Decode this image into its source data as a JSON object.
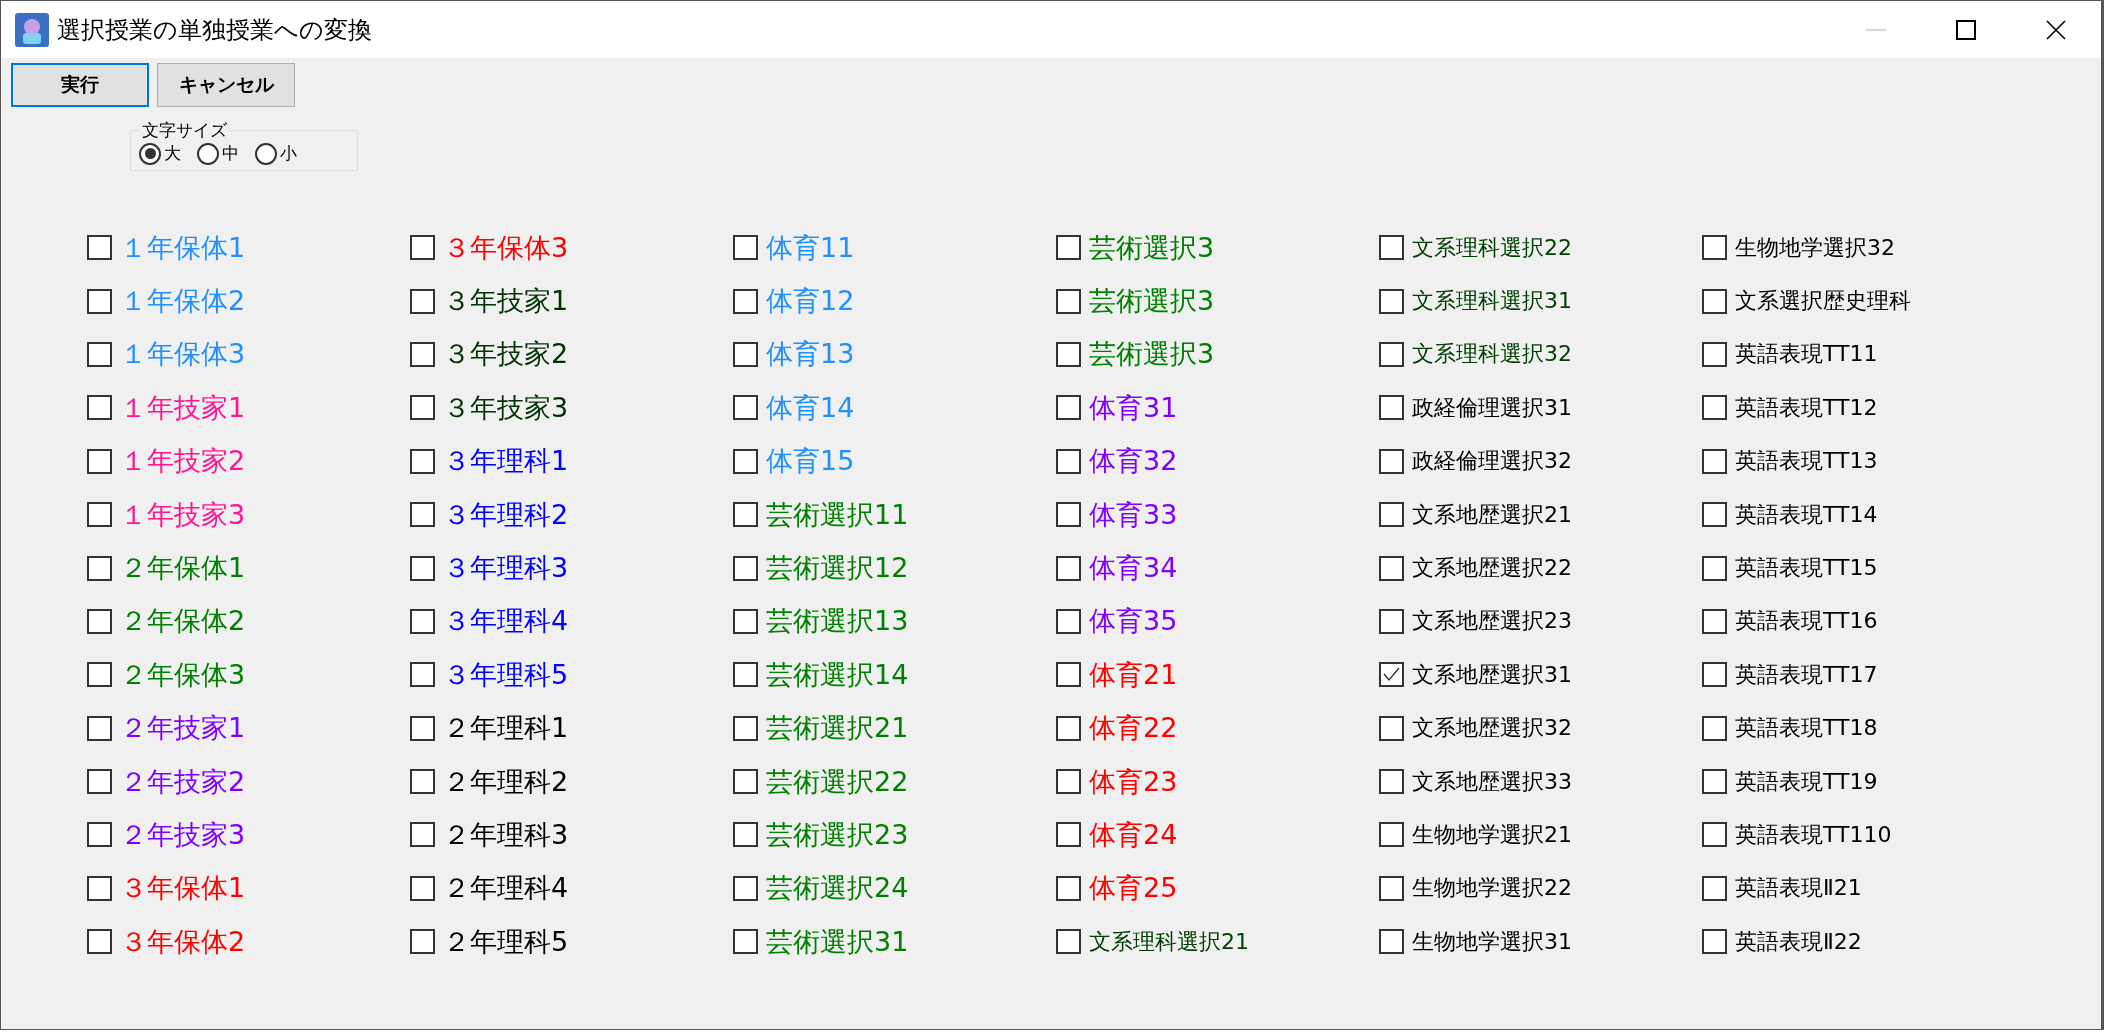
{
  "window": {
    "title": "選択授業の単独授業への変換"
  },
  "buttons": [
    {
      "label": "実行",
      "focused": true
    },
    {
      "label": "キャンセル",
      "focused": false
    }
  ],
  "font_size_group": {
    "title": "文字サイズ",
    "options": [
      {
        "label": "大",
        "selected": true
      },
      {
        "label": "中",
        "selected": false
      },
      {
        "label": "小",
        "selected": false
      }
    ]
  },
  "columns": [
    [
      {
        "label": "１年保体1",
        "color": "#1e90ff",
        "kind": "large",
        "checked": false
      },
      {
        "label": "１年保体2",
        "color": "#1e90ff",
        "kind": "large",
        "checked": false
      },
      {
        "label": "１年保体3",
        "color": "#1e90ff",
        "kind": "large",
        "checked": false
      },
      {
        "label": "１年技家1",
        "color": "#ff1493",
        "kind": "large",
        "checked": false
      },
      {
        "label": "１年技家2",
        "color": "#ff1493",
        "kind": "large",
        "checked": false
      },
      {
        "label": "１年技家3",
        "color": "#ff1493",
        "kind": "large",
        "checked": false
      },
      {
        "label": "２年保体1",
        "color": "#008000",
        "kind": "large",
        "checked": false
      },
      {
        "label": "２年保体2",
        "color": "#008000",
        "kind": "large",
        "checked": false
      },
      {
        "label": "２年保体3",
        "color": "#008000",
        "kind": "large",
        "checked": false
      },
      {
        "label": "２年技家1",
        "color": "#8000ff",
        "kind": "large",
        "checked": false
      },
      {
        "label": "２年技家2",
        "color": "#8000ff",
        "kind": "large",
        "checked": false
      },
      {
        "label": "２年技家3",
        "color": "#8000ff",
        "kind": "large",
        "checked": false
      },
      {
        "label": "３年保体1",
        "color": "#ff0000",
        "kind": "large",
        "checked": false
      },
      {
        "label": "３年保体2",
        "color": "#ff0000",
        "kind": "large",
        "checked": false
      }
    ],
    [
      {
        "label": "３年保体3",
        "color": "#ff0000",
        "kind": "large",
        "checked": false
      },
      {
        "label": "３年技家1",
        "color": "#003300",
        "kind": "large",
        "checked": false
      },
      {
        "label": "３年技家2",
        "color": "#003300",
        "kind": "large",
        "checked": false
      },
      {
        "label": "３年技家3",
        "color": "#003300",
        "kind": "large",
        "checked": false
      },
      {
        "label": "３年理科1",
        "color": "#0000ff",
        "kind": "large",
        "checked": false
      },
      {
        "label": "３年理科2",
        "color": "#0000ff",
        "kind": "large",
        "checked": false
      },
      {
        "label": "３年理科3",
        "color": "#0000ff",
        "kind": "large",
        "checked": false
      },
      {
        "label": "３年理科4",
        "color": "#0000ff",
        "kind": "large",
        "checked": false
      },
      {
        "label": "３年理科5",
        "color": "#0000ff",
        "kind": "large",
        "checked": false
      },
      {
        "label": "２年理科1",
        "color": "#000000",
        "kind": "large",
        "checked": false
      },
      {
        "label": "２年理科2",
        "color": "#000000",
        "kind": "large",
        "checked": false
      },
      {
        "label": "２年理科3",
        "color": "#000000",
        "kind": "large",
        "checked": false
      },
      {
        "label": "２年理科4",
        "color": "#000000",
        "kind": "large",
        "checked": false
      },
      {
        "label": "２年理科5",
        "color": "#000000",
        "kind": "large",
        "checked": false
      }
    ],
    [
      {
        "label": "体育11",
        "color": "#1e90ff",
        "kind": "large",
        "checked": false
      },
      {
        "label": "体育12",
        "color": "#1e90ff",
        "kind": "large",
        "checked": false
      },
      {
        "label": "体育13",
        "color": "#1e90ff",
        "kind": "large",
        "checked": false
      },
      {
        "label": "体育14",
        "color": "#1e90ff",
        "kind": "large",
        "checked": false
      },
      {
        "label": "体育15",
        "color": "#1e90ff",
        "kind": "large",
        "checked": false
      },
      {
        "label": "芸術選択11",
        "color": "#008000",
        "kind": "large",
        "checked": false
      },
      {
        "label": "芸術選択12",
        "color": "#008000",
        "kind": "large",
        "checked": false
      },
      {
        "label": "芸術選択13",
        "color": "#008000",
        "kind": "large",
        "checked": false
      },
      {
        "label": "芸術選択14",
        "color": "#008000",
        "kind": "large",
        "checked": false
      },
      {
        "label": "芸術選択21",
        "color": "#008000",
        "kind": "large",
        "checked": false
      },
      {
        "label": "芸術選択22",
        "color": "#008000",
        "kind": "large",
        "checked": false
      },
      {
        "label": "芸術選択23",
        "color": "#008000",
        "kind": "large",
        "checked": false
      },
      {
        "label": "芸術選択24",
        "color": "#008000",
        "kind": "large",
        "checked": false
      },
      {
        "label": "芸術選択31",
        "color": "#008000",
        "kind": "large",
        "checked": false
      }
    ],
    [
      {
        "label": "芸術選択3",
        "color": "#008000",
        "kind": "large",
        "checked": false
      },
      {
        "label": "芸術選択3",
        "color": "#008000",
        "kind": "large",
        "checked": false
      },
      {
        "label": "芸術選択3",
        "color": "#008000",
        "kind": "large",
        "checked": false
      },
      {
        "label": "体育31",
        "color": "#8000ff",
        "kind": "large",
        "checked": false
      },
      {
        "label": "体育32",
        "color": "#8000ff",
        "kind": "large",
        "checked": false
      },
      {
        "label": "体育33",
        "color": "#8000ff",
        "kind": "large",
        "checked": false
      },
      {
        "label": "体育34",
        "color": "#8000ff",
        "kind": "large",
        "checked": false
      },
      {
        "label": "体育35",
        "color": "#8000ff",
        "kind": "large",
        "checked": false
      },
      {
        "label": "体育21",
        "color": "#ff0000",
        "kind": "large",
        "checked": false
      },
      {
        "label": "体育22",
        "color": "#ff0000",
        "kind": "large",
        "checked": false
      },
      {
        "label": "体育23",
        "color": "#ff0000",
        "kind": "large",
        "checked": false
      },
      {
        "label": "体育24",
        "color": "#ff0000",
        "kind": "large",
        "checked": false
      },
      {
        "label": "体育25",
        "color": "#ff0000",
        "kind": "large",
        "checked": false
      },
      {
        "label": "文系理科選択21",
        "color": "#004000",
        "kind": "small",
        "checked": false
      }
    ],
    [
      {
        "label": "文系理科選択22",
        "color": "#004000",
        "kind": "small",
        "checked": false
      },
      {
        "label": "文系理科選択31",
        "color": "#004000",
        "kind": "small",
        "checked": false
      },
      {
        "label": "文系理科選択32",
        "color": "#004000",
        "kind": "small",
        "checked": false
      },
      {
        "label": "政経倫理選択31",
        "color": "#000000",
        "kind": "small",
        "checked": false
      },
      {
        "label": "政経倫理選択32",
        "color": "#000000",
        "kind": "small",
        "checked": false
      },
      {
        "label": "文系地歴選択21",
        "color": "#000000",
        "kind": "small",
        "checked": false
      },
      {
        "label": "文系地歴選択22",
        "color": "#000000",
        "kind": "small",
        "checked": false
      },
      {
        "label": "文系地歴選択23",
        "color": "#000000",
        "kind": "small",
        "checked": false
      },
      {
        "label": "文系地歴選択31",
        "color": "#000000",
        "kind": "small",
        "checked": true
      },
      {
        "label": "文系地歴選択32",
        "color": "#000000",
        "kind": "small",
        "checked": false
      },
      {
        "label": "文系地歴選択33",
        "color": "#000000",
        "kind": "small",
        "checked": false
      },
      {
        "label": "生物地学選択21",
        "color": "#000000",
        "kind": "small",
        "checked": false
      },
      {
        "label": "生物地学選択22",
        "color": "#000000",
        "kind": "small",
        "checked": false
      },
      {
        "label": "生物地学選択31",
        "color": "#000000",
        "kind": "small",
        "checked": false
      }
    ],
    [
      {
        "label": "生物地学選択32",
        "color": "#000000",
        "kind": "small",
        "checked": false
      },
      {
        "label": "文系選択歴史理科",
        "color": "#000000",
        "kind": "small",
        "checked": false
      },
      {
        "label": "英語表現TT11",
        "color": "#000000",
        "kind": "small",
        "checked": false
      },
      {
        "label": "英語表現TT12",
        "color": "#000000",
        "kind": "small",
        "checked": false
      },
      {
        "label": "英語表現TT13",
        "color": "#000000",
        "kind": "small",
        "checked": false
      },
      {
        "label": "英語表現TT14",
        "color": "#000000",
        "kind": "small",
        "checked": false
      },
      {
        "label": "英語表現TT15",
        "color": "#000000",
        "kind": "small",
        "checked": false
      },
      {
        "label": "英語表現TT16",
        "color": "#000000",
        "kind": "small",
        "checked": false
      },
      {
        "label": "英語表現TT17",
        "color": "#000000",
        "kind": "small",
        "checked": false
      },
      {
        "label": "英語表現TT18",
        "color": "#000000",
        "kind": "small",
        "checked": false
      },
      {
        "label": "英語表現TT19",
        "color": "#000000",
        "kind": "small",
        "checked": false
      },
      {
        "label": "英語表現TT110",
        "color": "#000000",
        "kind": "small",
        "checked": false
      },
      {
        "label": "英語表現Ⅱ21",
        "color": "#000000",
        "kind": "small",
        "checked": false
      },
      {
        "label": "英語表現Ⅱ22",
        "color": "#000000",
        "kind": "small",
        "checked": false
      }
    ]
  ]
}
